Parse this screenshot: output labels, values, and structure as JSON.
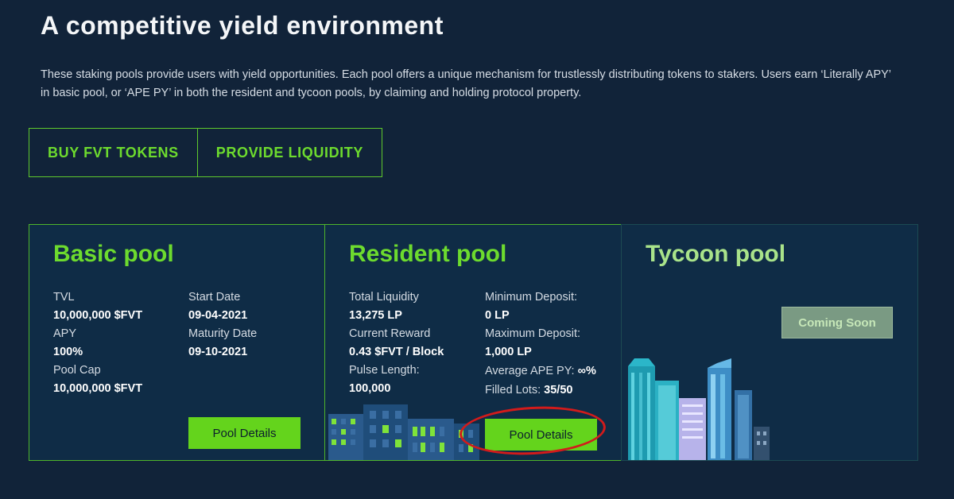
{
  "header": {
    "title": "A competitive yield environment",
    "description": "These staking pools provide users with yield opportunities. Each pool offers a unique mechanism for trustlessly distributing tokens to stakers. Users earn ‘Literally APY’ in basic pool, or ‘APE PY’ in both the resident and tycoon pools, by claiming and holding protocol property."
  },
  "actions": {
    "buy_label": "BUY FVT TOKENS",
    "liquidity_label": "PROVIDE LIQUIDITY"
  },
  "pools": {
    "basic": {
      "title": "Basic pool",
      "tvl_label": "TVL",
      "tvl_value": "10,000,000 $FVT",
      "apy_label": "APY",
      "apy_value": "100%",
      "cap_label": "Pool Cap",
      "cap_value": "10,000,000 $FVT",
      "start_label": "Start Date",
      "start_value": "09-04-2021",
      "maturity_label": "Maturity Date",
      "maturity_value": "09-10-2021",
      "button_label": "Pool Details"
    },
    "resident": {
      "title": "Resident pool",
      "liquidity_label": "Total Liquidity",
      "liquidity_value": "13,275 LP",
      "reward_label": "Current Reward",
      "reward_value": "0.43 $FVT / Block",
      "pulse_label": "Pulse Length:",
      "pulse_value": "100,000",
      "min_label": "Minimum Deposit:",
      "min_value": "0 LP",
      "max_label": "Maximum Deposit:",
      "max_value": "1,000 LP",
      "ape_label": "Average APE PY:",
      "ape_value": "∞%",
      "lots_label": "Filled Lots:",
      "lots_value": "35/50",
      "button_label": "Pool Details"
    },
    "tycoon": {
      "title": "Tycoon pool",
      "button_label": "Coming Soon"
    }
  },
  "colors": {
    "background": "#112339",
    "card": "#0f2c46",
    "accent_green": "#6ddb2e",
    "button_green": "#64d41c",
    "annotation_red": "#d21b1b"
  }
}
